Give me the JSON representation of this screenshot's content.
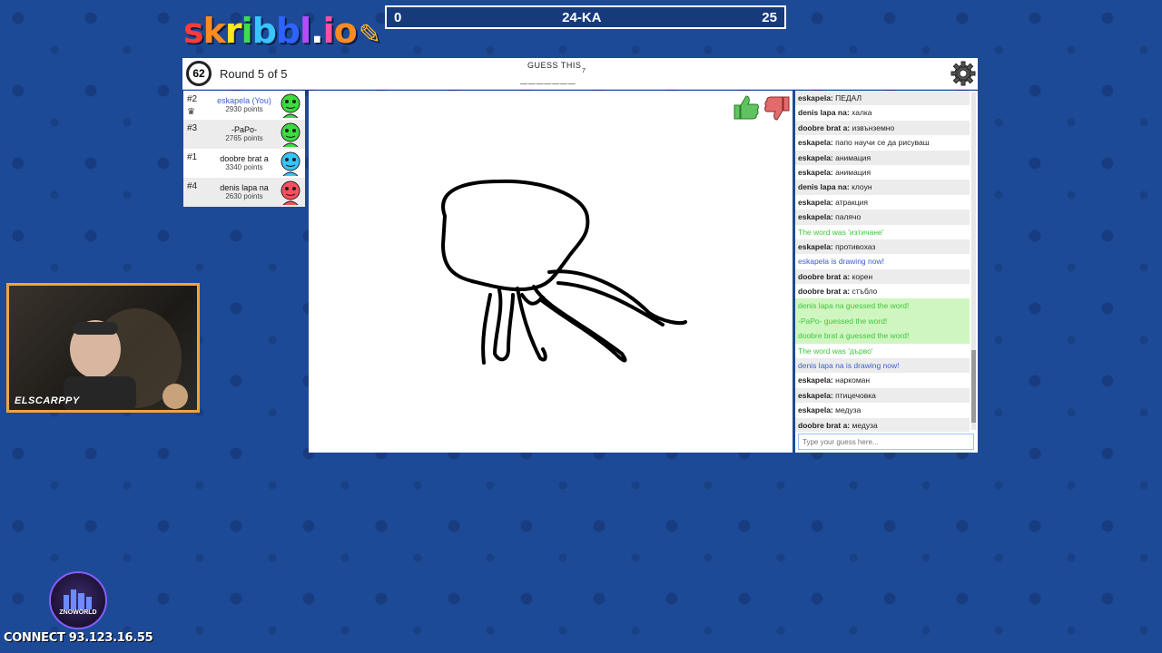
{
  "scorebar": {
    "left": "0",
    "title": "24-KA",
    "right": "25"
  },
  "logo": {
    "letters": [
      "s",
      "k",
      "r",
      "i",
      "b",
      "b",
      "l",
      ".",
      "i",
      "o"
    ],
    "colors": [
      "#ff3b3b",
      "#ff8b1f",
      "#ffe81f",
      "#3ddc55",
      "#37c4ff",
      "#2f63ff",
      "#b64cff",
      "#ffffff",
      "#ff4fa0",
      "#ff8b1f"
    ]
  },
  "header": {
    "timer": "62",
    "round": "Round 5 of 5",
    "guess_label": "GUESS THIS",
    "word_hint": "_______",
    "word_length": "7"
  },
  "players": [
    {
      "rank": "#2",
      "name": "eskapela (You)",
      "points": "2930 points",
      "color": "#3ddc3d",
      "self": true,
      "crown": true
    },
    {
      "rank": "#3",
      "name": "-PaPo-",
      "points": "2765 points",
      "color": "#3ddc3d"
    },
    {
      "rank": "#1",
      "name": "doobre brat a",
      "points": "3340 points",
      "color": "#37c4ff"
    },
    {
      "rank": "#4",
      "name": "denis lapa na",
      "points": "2630 points",
      "color": "#ff4f5e"
    }
  ],
  "chat": {
    "messages": [
      {
        "name": "eskapela:",
        "text": "ПЕДАЛ",
        "style": "normal"
      },
      {
        "name": "denis lapa na:",
        "text": "халка",
        "style": "normal"
      },
      {
        "name": "doobre brat a:",
        "text": "извънземно",
        "style": "normal"
      },
      {
        "name": "eskapela:",
        "text": "папо научи се да рисуваш",
        "style": "normal"
      },
      {
        "name": "eskapela:",
        "text": "анимация",
        "style": "normal"
      },
      {
        "name": "eskapela:",
        "text": "анимация",
        "style": "normal"
      },
      {
        "name": "denis lapa na:",
        "text": "клоун",
        "style": "normal"
      },
      {
        "name": "eskapela:",
        "text": "атракция",
        "style": "normal"
      },
      {
        "name": "eskapela:",
        "text": "палячо",
        "style": "normal"
      },
      {
        "name": "",
        "text": "The word was 'изтичане'",
        "style": "green"
      },
      {
        "name": "eskapela:",
        "text": "противохаз",
        "style": "normal"
      },
      {
        "name": "",
        "text": "eskapela is drawing now!",
        "style": "blue"
      },
      {
        "name": "doobre brat a:",
        "text": "корен",
        "style": "normal"
      },
      {
        "name": "doobre brat a:",
        "text": "стъбло",
        "style": "normal"
      },
      {
        "name": "",
        "text": "denis lapa na guessed the word!",
        "style": "greenbg"
      },
      {
        "name": "",
        "text": "-PaPo- guessed the word!",
        "style": "greenbg"
      },
      {
        "name": "",
        "text": "doobre brat a guessed the word!",
        "style": "greenbg"
      },
      {
        "name": "",
        "text": "The word was 'дърво'",
        "style": "green"
      },
      {
        "name": "",
        "text": "denis lapa na is drawing now!",
        "style": "blue"
      },
      {
        "name": "eskapela:",
        "text": "наркоман",
        "style": "normal"
      },
      {
        "name": "eskapela:",
        "text": "птицечовка",
        "style": "normal"
      },
      {
        "name": "eskapela:",
        "text": "медуза",
        "style": "normal"
      },
      {
        "name": "doobre brat a:",
        "text": "медуза",
        "style": "normal"
      }
    ],
    "input_placeholder": "Type your guess here..."
  },
  "webcam": {
    "name": "ELSCARPPY"
  },
  "badge": {
    "text": "ZNOWORLD"
  },
  "connect": "CONNECT 93.123.16.55",
  "colors": {
    "accent": "#1d4a96",
    "header_bg": "#163a7a",
    "green": "#3ec73e",
    "blue": "#3b5cd4"
  }
}
